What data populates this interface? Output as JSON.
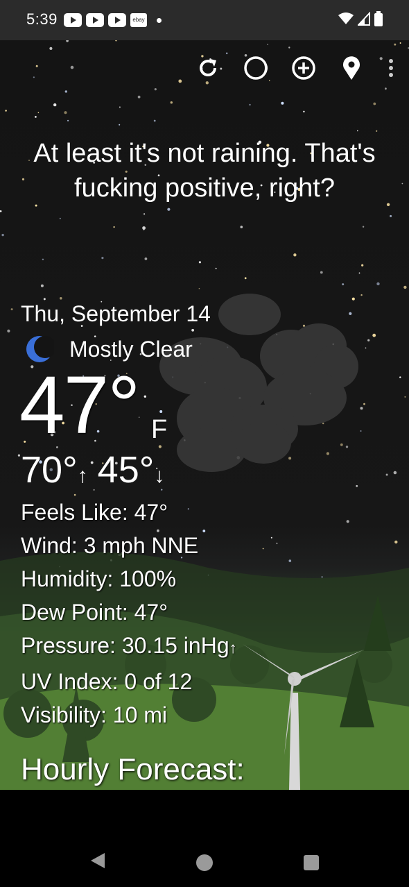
{
  "status_bar": {
    "time": "5:39",
    "notification_icons": [
      "youtube-icon",
      "youtube-icon",
      "youtube-icon",
      "ebay-icon"
    ],
    "ebay_text": "ebay"
  },
  "toolbar": {
    "icons": [
      "refresh-icon",
      "moon-phase-icon",
      "add-location-icon",
      "location-pin-icon",
      "overflow-menu-icon"
    ]
  },
  "quote": "At least it's not raining. That's fucking positive, right?",
  "current": {
    "date": "Thu, September 14",
    "condition": "Mostly Clear",
    "temperature": "47°",
    "unit": "F",
    "high": "70°",
    "high_arrow": "↑",
    "low": "45°",
    "low_arrow": "↓"
  },
  "details": {
    "feels_like": "Feels Like:  47°",
    "wind": "Wind:  3 mph NNE",
    "humidity": "Humidity:  100%",
    "dew_point": "Dew Point:  47°",
    "pressure": "Pressure:  30.15 inHg",
    "pressure_trend": "↑",
    "uv_index": "UV Index:  0 of 12",
    "visibility": "Visibility:  10 mi"
  },
  "hourly_title": "Hourly Forecast:",
  "colors": {
    "status_bar": "#2b2b2b",
    "sky": "#141414",
    "moon": "#3a6fd8",
    "grass": "#5e8f3c"
  }
}
